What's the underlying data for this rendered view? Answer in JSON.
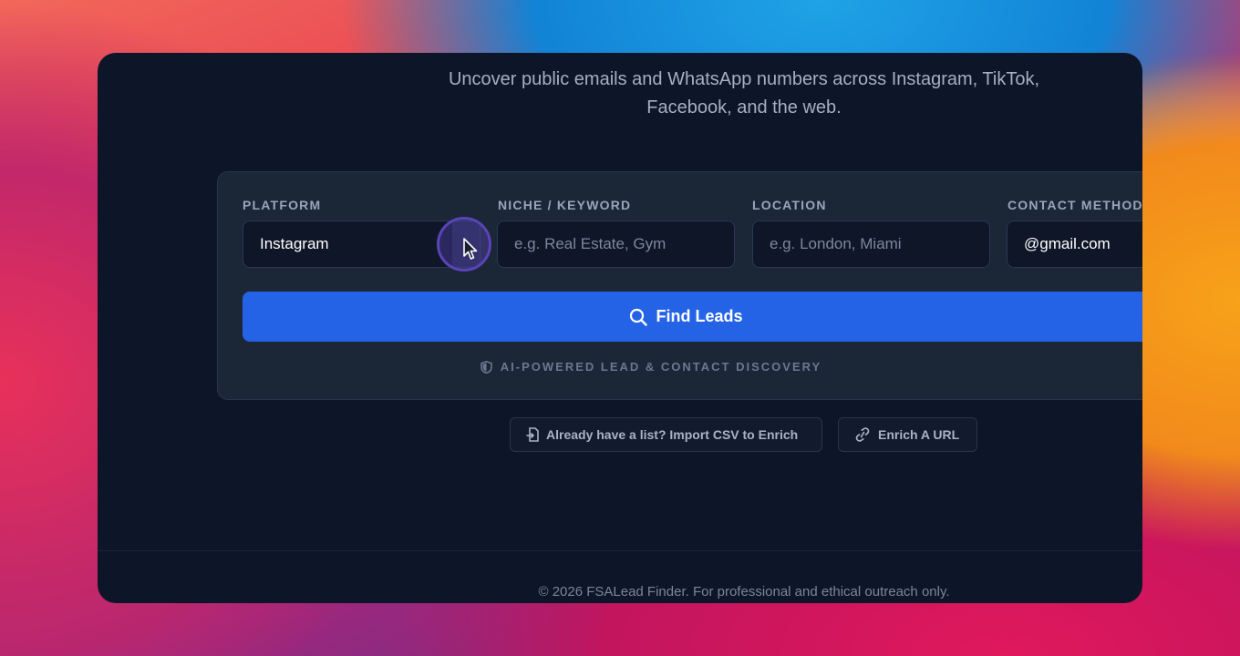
{
  "hero": {
    "subtitle_line1": "Uncover public emails and WhatsApp numbers across Instagram, TikTok,",
    "subtitle_line2": "Facebook, and the web."
  },
  "search_form": {
    "platform": {
      "label": "PLATFORM",
      "value": "Instagram"
    },
    "niche": {
      "label": "NICHE / KEYWORD",
      "placeholder": "e.g. Real Estate, Gym"
    },
    "location": {
      "label": "LOCATION",
      "placeholder": "e.g. London, Miami"
    },
    "contact_method": {
      "label": "CONTACT METHOD",
      "value": "@gmail.com"
    },
    "submit_label": "Find Leads",
    "tagline": "AI-POWERED LEAD & CONTACT DISCOVERY"
  },
  "actions": {
    "import_csv_label": "Already have a list? Import CSV to Enrich",
    "enrich_url_label": "Enrich A URL"
  },
  "footer": {
    "text": "© 2026 FSALead Finder. For professional and ethical outreach only."
  },
  "colors": {
    "window_bg": "#0d1528",
    "card_bg": "#1b2637",
    "accent": "#2563e6"
  },
  "icons": [
    "search-icon",
    "shield-icon",
    "file-import-icon",
    "link-icon",
    "mouse-cursor-icon"
  ]
}
